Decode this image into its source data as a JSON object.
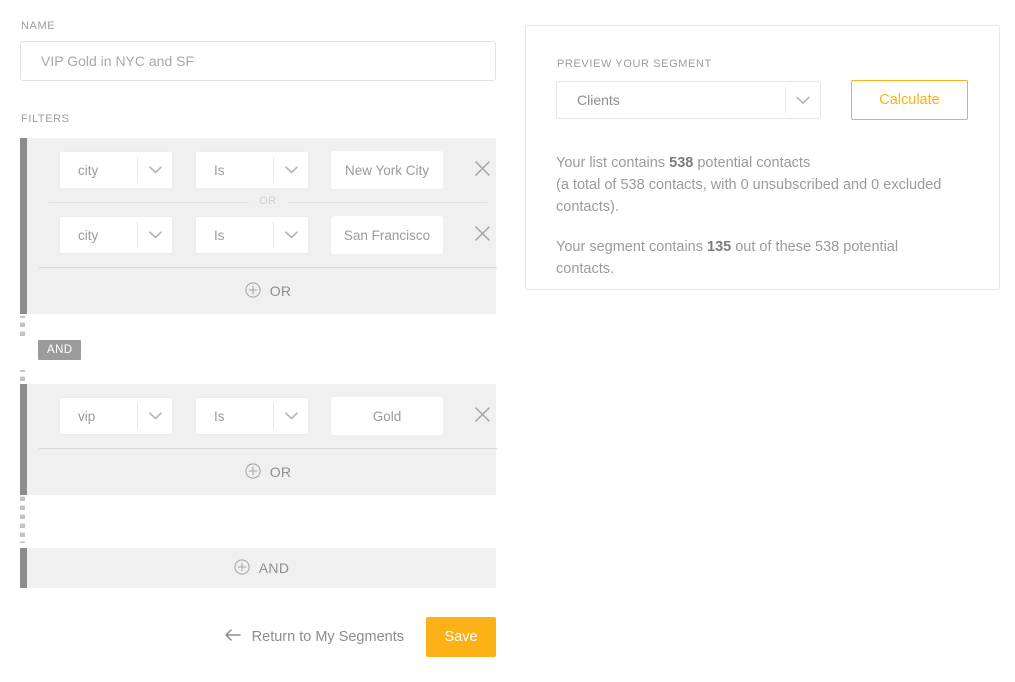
{
  "name_section": {
    "label": "NAME",
    "value": "",
    "placeholder": "VIP Gold in NYC and SF"
  },
  "filters_section": {
    "label": "FILTERS",
    "groups": [
      {
        "conditions": [
          {
            "attribute": "city",
            "operator": "Is",
            "value": "",
            "value_placeholder": "New York City",
            "remove_label": "×"
          },
          {
            "attribute": "city",
            "operator": "Is",
            "value": "",
            "value_placeholder": "San Francisco",
            "remove_label": "×"
          }
        ],
        "inner_joiner": "OR",
        "add_label": "OR"
      },
      {
        "conditions": [
          {
            "attribute": "vip",
            "operator": "Is",
            "value": "",
            "value_placeholder": "Gold",
            "remove_label": "×"
          }
        ],
        "add_label": "OR"
      }
    ],
    "group_joiner": "AND",
    "add_group_label": "AND"
  },
  "footer": {
    "return_label": "Return to My Segments",
    "save_label": "Save"
  },
  "preview": {
    "label": "PREVIEW YOUR SEGMENT",
    "audience": "Clients",
    "calculate_label": "Calculate",
    "stats": {
      "line1_pre": "Your list contains ",
      "line1_count": "538",
      "line1_post": " potential contacts",
      "line2": "(a total of 538 contacts, with 0 unsubscribed and 0 excluded contacts).",
      "line3_pre": "Your segment contains ",
      "line3_count": "135",
      "line3_post": " out of these 538 potential contacts."
    }
  },
  "colors": {
    "accent": "#fcb116",
    "group_bar": "#8c8c8c",
    "group_bg": "#f0f0f0",
    "text": "#9b9b9b"
  }
}
